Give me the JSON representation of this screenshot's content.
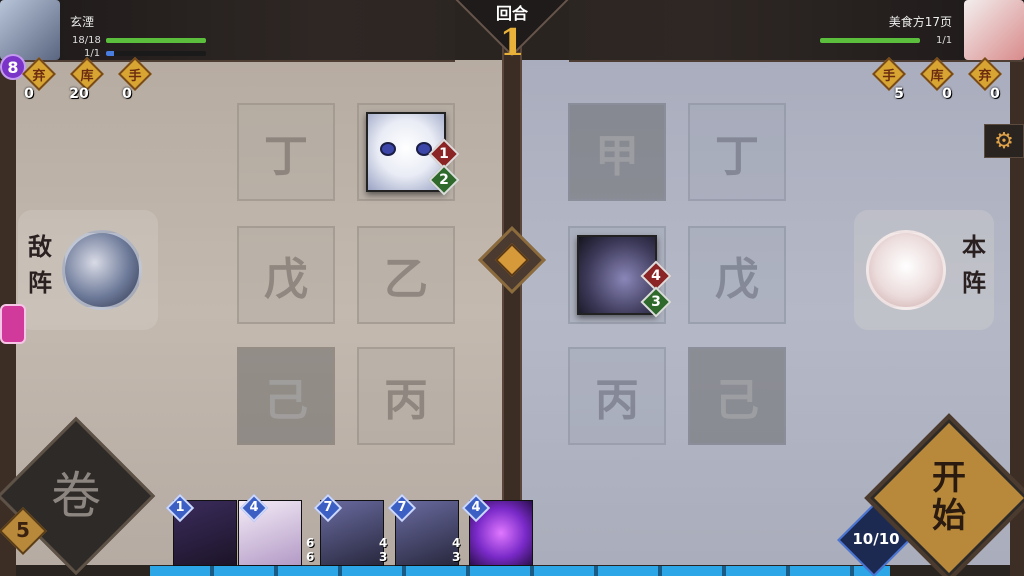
{
  "round": {
    "label": "回合",
    "number": "1"
  },
  "player_left": {
    "name": "玄湮",
    "hp_text": "18/18",
    "hp_fraction": 1.0,
    "mana_text": "1/1",
    "mana_fraction": 0.08,
    "level": "8",
    "stats": [
      {
        "char": "弃",
        "value": "0"
      },
      {
        "char": "库",
        "value": "20"
      },
      {
        "char": "手",
        "value": "0"
      }
    ],
    "side_label": [
      "敌",
      "阵"
    ]
  },
  "player_right": {
    "name": "美食方17页",
    "hp_text": "1/1",
    "hp_fraction": 1.0,
    "stats": [
      {
        "char": "手",
        "value": "5"
      },
      {
        "char": "库",
        "value": "0"
      },
      {
        "char": "弃",
        "value": "0"
      }
    ],
    "side_label": [
      "本",
      "阵"
    ]
  },
  "board_left": {
    "cells": [
      "丁",
      "戊",
      "乙",
      "己",
      "丙"
    ]
  },
  "board_right": {
    "cells": [
      "甲",
      "丁",
      "戊",
      "丙",
      "己"
    ]
  },
  "units": {
    "cat": {
      "attack": "1",
      "health": "2"
    },
    "ghost": {
      "attack": "4",
      "health": "3"
    }
  },
  "hand": [
    {
      "cost": "1",
      "attack": "",
      "health": ""
    },
    {
      "cost": "4",
      "attack": "6",
      "health": "6"
    },
    {
      "cost": "7",
      "attack": "4",
      "health": "3"
    },
    {
      "cost": "7",
      "attack": "4",
      "health": "3"
    },
    {
      "cost": "4",
      "attack": "",
      "health": ""
    }
  ],
  "deck_count": "5",
  "deck_glyph": "卷",
  "start_button": {
    "label_top": "开",
    "label_bottom": "始"
  },
  "energy": "10/10",
  "colors": {
    "accent_gold": "#d8a533",
    "hp_green": "#5bbf3d",
    "mana_blue": "#4a7de0",
    "level_purple": "#7a35c8"
  },
  "icons": {
    "settings": "gear-icon"
  }
}
